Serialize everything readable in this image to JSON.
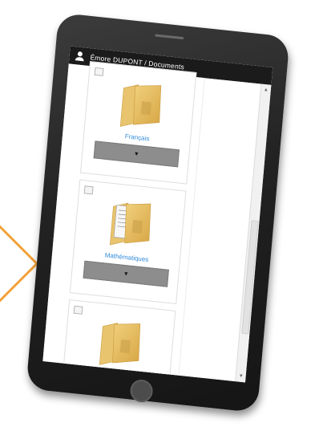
{
  "header": {
    "breadcrumb": "Émore DUPONT / Documents",
    "user_icon": "user-icon"
  },
  "folders": [
    {
      "label": "Français",
      "icon": "folder-icon",
      "button_icon": "caret-down-icon"
    },
    {
      "label": "Mathématiques",
      "icon": "folder-with-papers-icon",
      "button_icon": "caret-down-icon"
    },
    {
      "label": "",
      "icon": "folder-icon"
    }
  ],
  "colors": {
    "accent_chevron": "#f2a23a",
    "link_blue": "#2f8ad8",
    "header_bg": "#1b1b1b",
    "button_gray": "#8d8d8d",
    "folder_tan": "#e2b85a"
  },
  "glyphs": {
    "caret": "▼",
    "scroll_up": "▲",
    "scroll_down": "▼"
  }
}
